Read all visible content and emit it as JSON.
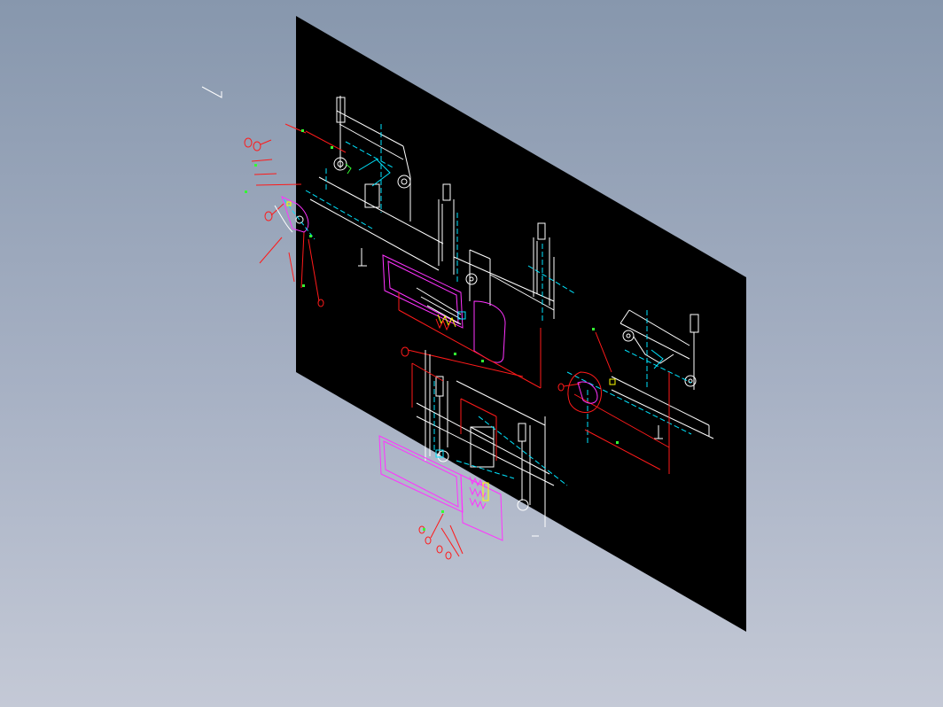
{
  "viewport": {
    "background_top": "#8797ad",
    "background_bottom": "#c4c9d6"
  },
  "sheet": {
    "fill": "#000000"
  },
  "colors": {
    "white": "#ffffff",
    "cyan": "#00e5ff",
    "red": "#ff1a1a",
    "magenta": "#ff33ff",
    "green": "#33ff33",
    "yellow": "#ffff00"
  }
}
